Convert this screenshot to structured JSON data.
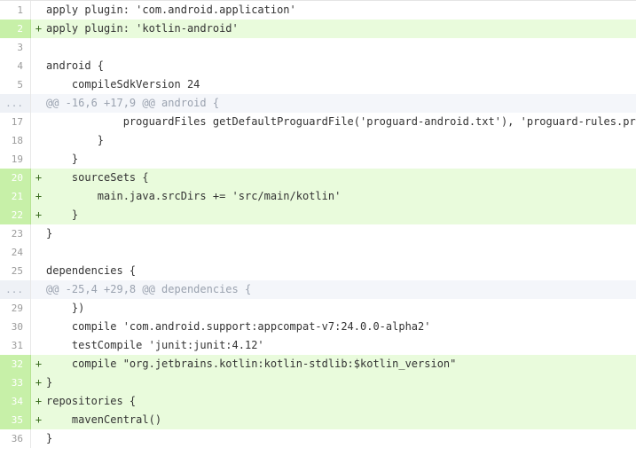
{
  "diff": {
    "lines": [
      {
        "kind": "context",
        "num": "1",
        "marker": "",
        "code": "apply plugin: 'com.android.application'"
      },
      {
        "kind": "add",
        "num": "2",
        "marker": "+",
        "code": "apply plugin: 'kotlin-android'"
      },
      {
        "kind": "context",
        "num": "3",
        "marker": "",
        "code": ""
      },
      {
        "kind": "context",
        "num": "4",
        "marker": "",
        "code": "android {"
      },
      {
        "kind": "context",
        "num": "5",
        "marker": "",
        "code": "    compileSdkVersion 24"
      },
      {
        "kind": "hunk",
        "num": "...",
        "marker": "",
        "code": "@@ -16,6 +17,9 @@ android {"
      },
      {
        "kind": "context",
        "num": "17",
        "marker": "",
        "code": "            proguardFiles getDefaultProguardFile('proguard-android.txt'), 'proguard-rules.pro'"
      },
      {
        "kind": "context",
        "num": "18",
        "marker": "",
        "code": "        }"
      },
      {
        "kind": "context",
        "num": "19",
        "marker": "",
        "code": "    }"
      },
      {
        "kind": "add",
        "num": "20",
        "marker": "+",
        "code": "    sourceSets {"
      },
      {
        "kind": "add",
        "num": "21",
        "marker": "+",
        "code": "        main.java.srcDirs += 'src/main/kotlin'"
      },
      {
        "kind": "add",
        "num": "22",
        "marker": "+",
        "code": "    }"
      },
      {
        "kind": "context",
        "num": "23",
        "marker": "",
        "code": "}"
      },
      {
        "kind": "context",
        "num": "24",
        "marker": "",
        "code": ""
      },
      {
        "kind": "context",
        "num": "25",
        "marker": "",
        "code": "dependencies {"
      },
      {
        "kind": "hunk",
        "num": "...",
        "marker": "",
        "code": "@@ -25,4 +29,8 @@ dependencies {"
      },
      {
        "kind": "context",
        "num": "29",
        "marker": "",
        "code": "    })"
      },
      {
        "kind": "context",
        "num": "30",
        "marker": "",
        "code": "    compile 'com.android.support:appcompat-v7:24.0.0-alpha2'"
      },
      {
        "kind": "context",
        "num": "31",
        "marker": "",
        "code": "    testCompile 'junit:junit:4.12'"
      },
      {
        "kind": "add",
        "num": "32",
        "marker": "+",
        "code": "    compile \"org.jetbrains.kotlin:kotlin-stdlib:$kotlin_version\""
      },
      {
        "kind": "add",
        "num": "33",
        "marker": "+",
        "code": "}"
      },
      {
        "kind": "add",
        "num": "34",
        "marker": "+",
        "code": "repositories {"
      },
      {
        "kind": "add",
        "num": "35",
        "marker": "+",
        "code": "    mavenCentral()"
      },
      {
        "kind": "context",
        "num": "36",
        "marker": "",
        "code": "}"
      }
    ]
  },
  "colors": {
    "added_background": "#e9fbdc",
    "added_gutter": "#c7f0a8",
    "hunk_background": "#f4f6fa"
  }
}
